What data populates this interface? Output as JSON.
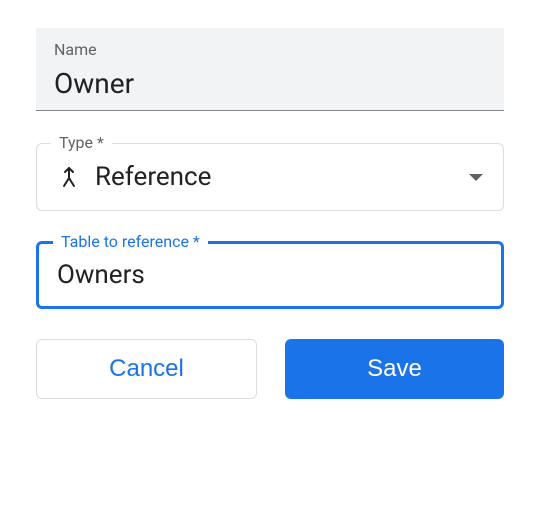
{
  "name_field": {
    "label": "Name",
    "value": "Owner"
  },
  "type_field": {
    "label": "Type *",
    "value": "Reference",
    "icon": "merge-icon"
  },
  "table_field": {
    "label": "Table to reference *",
    "value": "Owners"
  },
  "buttons": {
    "cancel": "Cancel",
    "save": "Save"
  }
}
